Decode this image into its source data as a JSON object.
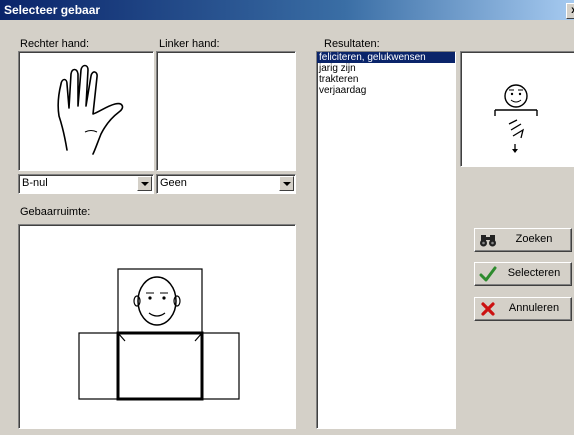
{
  "window": {
    "title": "Selecteer gebaar",
    "close_label": "x"
  },
  "right_hand": {
    "label": "Rechter hand:",
    "selected": "B-nul"
  },
  "left_hand": {
    "label": "Linker hand:",
    "selected": "Geen"
  },
  "results": {
    "label": "Resultaten:",
    "items": [
      {
        "text": "feliciteren, gelukwensen",
        "selected": true
      },
      {
        "text": "jarig zijn",
        "selected": false
      },
      {
        "text": "trakteren",
        "selected": false
      },
      {
        "text": "verjaardag",
        "selected": false
      }
    ]
  },
  "space": {
    "label": "Gebaarruimte:"
  },
  "buttons": {
    "search": {
      "label": "Zoeken",
      "icon": "binoculars-icon"
    },
    "select": {
      "label": "Selecteren",
      "icon": "checkmark-icon",
      "color": "#2e8b2e"
    },
    "cancel": {
      "label": "Annuleren",
      "icon": "cross-icon",
      "color": "#cc1111"
    }
  }
}
